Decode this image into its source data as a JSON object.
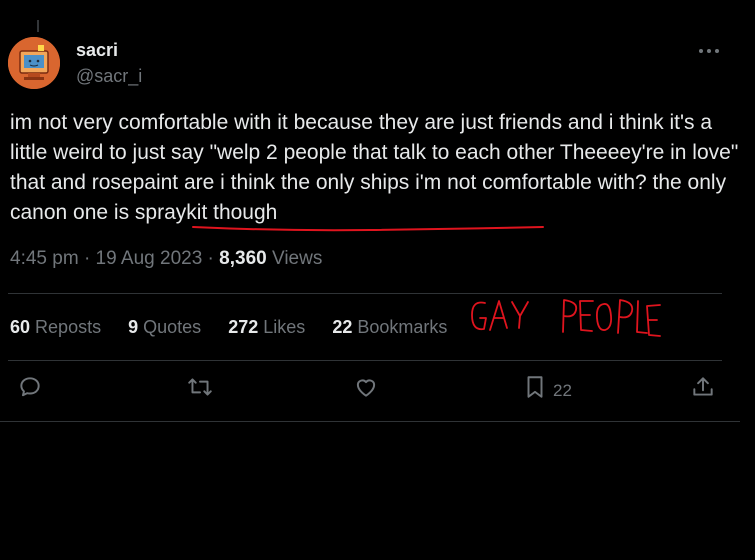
{
  "author": {
    "display_name": "sacri",
    "handle": "@sacr_i"
  },
  "tweet": {
    "text_part1": "im not very comfortable with it because they are just friends and i think it's a little weird to just say \"welp 2 people that talk to each other Theeeey're in love\" that and rosepaint are i think the only ships i'm not comfortable with? ",
    "text_part2": "the only canon one is spraykit though",
    "time": "4:45 pm",
    "separator": "·",
    "date": "19 Aug 2023",
    "views_count": "8,360",
    "views_label": "Views"
  },
  "stats": {
    "reposts_count": "60",
    "reposts_label": "Reposts",
    "quotes_count": "9",
    "quotes_label": "Quotes",
    "likes_count": "272",
    "likes_label": "Likes",
    "bookmarks_count": "22",
    "bookmarks_label": "Bookmarks"
  },
  "actions": {
    "bookmark_count": "22"
  },
  "annotation": {
    "handwritten_text": "GAY PEOPLE",
    "ink_color": "#e0141e"
  },
  "colors": {
    "background": "#000000",
    "primary_text": "#e7e9ea",
    "secondary_text": "#71767b",
    "divider": "#2f3336",
    "avatar_bg": "#d9662f"
  }
}
